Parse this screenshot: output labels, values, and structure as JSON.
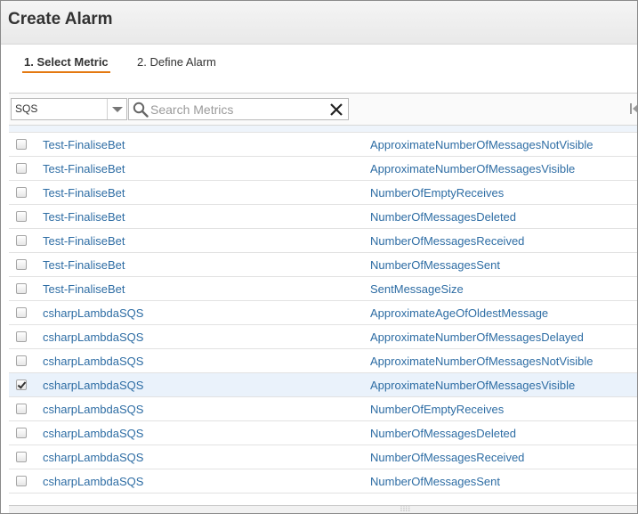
{
  "window": {
    "title": "Create Alarm"
  },
  "steps": [
    {
      "label": "1. Select Metric",
      "active": true
    },
    {
      "label": "2. Define Alarm",
      "active": false
    }
  ],
  "filter": {
    "namespace_value": "SQS",
    "search_placeholder": "Search Metrics",
    "search_value": ""
  },
  "colors": {
    "link": "#2e6da4",
    "accent": "#e47911",
    "selected_row": "#eaf2fb"
  },
  "rows": [
    {
      "queue": "Test-FinaliseBet",
      "metric": "ApproximateNumberOfMessagesNotVisible",
      "checked": false
    },
    {
      "queue": "Test-FinaliseBet",
      "metric": "ApproximateNumberOfMessagesVisible",
      "checked": false
    },
    {
      "queue": "Test-FinaliseBet",
      "metric": "NumberOfEmptyReceives",
      "checked": false
    },
    {
      "queue": "Test-FinaliseBet",
      "metric": "NumberOfMessagesDeleted",
      "checked": false
    },
    {
      "queue": "Test-FinaliseBet",
      "metric": "NumberOfMessagesReceived",
      "checked": false
    },
    {
      "queue": "Test-FinaliseBet",
      "metric": "NumberOfMessagesSent",
      "checked": false
    },
    {
      "queue": "Test-FinaliseBet",
      "metric": "SentMessageSize",
      "checked": false
    },
    {
      "queue": "csharpLambdaSQS",
      "metric": "ApproximateAgeOfOldestMessage",
      "checked": false
    },
    {
      "queue": "csharpLambdaSQS",
      "metric": "ApproximateNumberOfMessagesDelayed",
      "checked": false
    },
    {
      "queue": "csharpLambdaSQS",
      "metric": "ApproximateNumberOfMessagesNotVisible",
      "checked": false
    },
    {
      "queue": "csharpLambdaSQS",
      "metric": "ApproximateNumberOfMessagesVisible",
      "checked": true
    },
    {
      "queue": "csharpLambdaSQS",
      "metric": "NumberOfEmptyReceives",
      "checked": false
    },
    {
      "queue": "csharpLambdaSQS",
      "metric": "NumberOfMessagesDeleted",
      "checked": false
    },
    {
      "queue": "csharpLambdaSQS",
      "metric": "NumberOfMessagesReceived",
      "checked": false
    },
    {
      "queue": "csharpLambdaSQS",
      "metric": "NumberOfMessagesSent",
      "checked": false
    }
  ],
  "icons": {
    "search": "search-icon",
    "clear": "close-icon",
    "dropdown": "chevron-down-icon",
    "pager": "first-page-icon",
    "resize": "resize-handle-icon"
  }
}
